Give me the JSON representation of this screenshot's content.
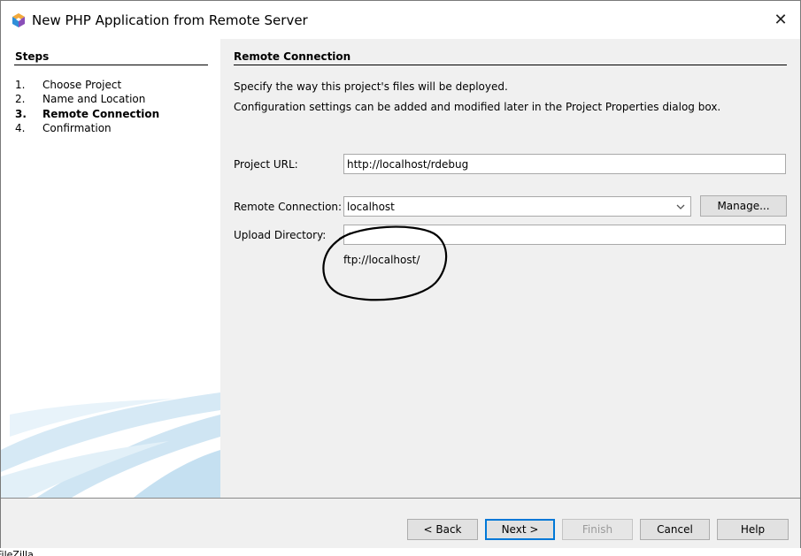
{
  "window": {
    "title": "New PHP Application from Remote Server",
    "close_glyph": "✕"
  },
  "sidebar": {
    "heading": "Steps",
    "steps": [
      {
        "num": "1.",
        "label": "Choose Project"
      },
      {
        "num": "2.",
        "label": "Name and Location"
      },
      {
        "num": "3.",
        "label": "Remote Connection"
      },
      {
        "num": "4.",
        "label": "Confirmation"
      }
    ]
  },
  "main": {
    "heading": "Remote Connection",
    "description_line1": "Specify the way this project's files will be deployed.",
    "description_line2": "Configuration settings can be added and modified later in the Project Properties dialog box.",
    "project_url_label": "Project URL:",
    "project_url_value": "http://localhost/rdebug",
    "remote_connection_label": "Remote Connection:",
    "remote_connection_value": "localhost",
    "manage_label": "Manage...",
    "upload_directory_label": "Upload Directory:",
    "upload_directory_value": "",
    "ftp_hint": "ftp://localhost/"
  },
  "footer": {
    "back_label": "< Back",
    "next_label": "Next >",
    "finish_label": "Finish",
    "cancel_label": "Cancel",
    "help_label": "Help"
  },
  "background_text": "FileZilla",
  "colors": {
    "focus_blue": "#0078d7",
    "panel_gray": "#f0f0f0",
    "annotation_black": "#000000"
  },
  "icons": {
    "app": "netbeans-cube-icon",
    "close": "close-icon",
    "dropdown": "chevron-down-icon"
  }
}
